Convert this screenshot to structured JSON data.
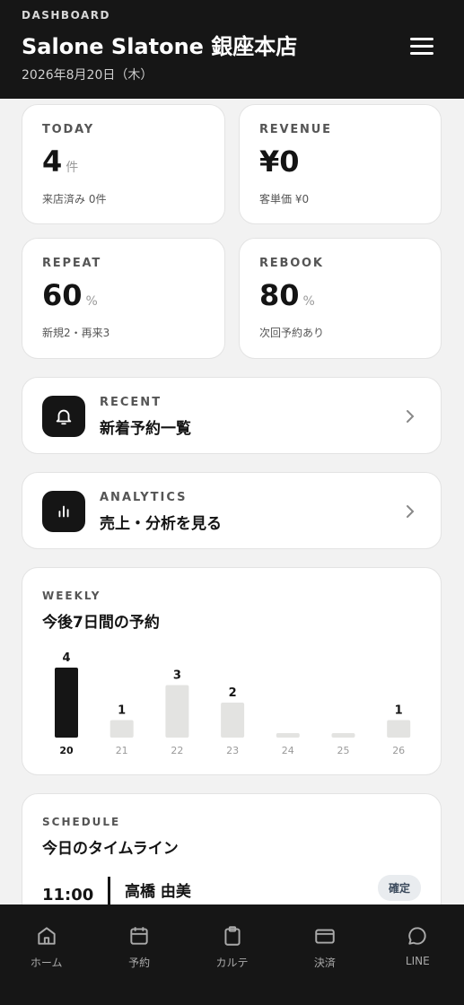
{
  "header": {
    "kicker": "DASHBOARD",
    "title": "Salone Slatone 銀座本店",
    "date": "2026年8月20日（木）"
  },
  "stats": {
    "today": {
      "label": "TODAY",
      "value": "4",
      "unit": "件",
      "sub": "来店済み 0件"
    },
    "revenue": {
      "label": "REVENUE",
      "value": "¥0",
      "unit": "",
      "sub": "客単価 ¥0"
    },
    "repeat": {
      "label": "REPEAT",
      "value": "60",
      "unit": "%",
      "sub": "新規2・再来3"
    },
    "rebook": {
      "label": "REBOOK",
      "value": "80",
      "unit": "%",
      "sub": "次回予約あり"
    }
  },
  "links": {
    "recent": {
      "kicker": "RECENT",
      "title": "新着予約一覧",
      "icon": "bell-icon"
    },
    "analytics": {
      "kicker": "ANALYTICS",
      "title": "売上・分析を見る",
      "icon": "bar-chart-icon"
    }
  },
  "weekly": {
    "kicker": "WEEKLY",
    "title": "今後7日間の予約"
  },
  "chart_data": {
    "type": "bar",
    "categories": [
      "20",
      "21",
      "22",
      "23",
      "24",
      "25",
      "26"
    ],
    "values": [
      4,
      1,
      3,
      2,
      0,
      0,
      1
    ],
    "highlight_index": 0,
    "colors": {
      "highlight": "#151515",
      "normal": "#e3e3e1"
    },
    "grid": false
  },
  "schedule": {
    "kicker": "SCHEDULE",
    "title": "今日のタイムライン",
    "items": [
      {
        "time": "11:00",
        "name": "高橋 由美",
        "status": "確定"
      }
    ]
  },
  "tabs": [
    {
      "label": "ホーム",
      "icon": "home-icon"
    },
    {
      "label": "予約",
      "icon": "calendar-icon"
    },
    {
      "label": "カルテ",
      "icon": "clipboard-icon"
    },
    {
      "label": "決済",
      "icon": "credit-card-icon"
    },
    {
      "label": "LINE",
      "icon": "chat-bubble-icon"
    }
  ]
}
